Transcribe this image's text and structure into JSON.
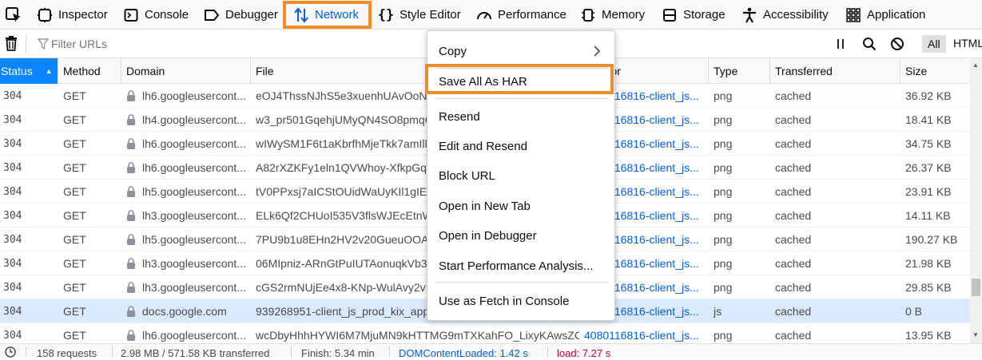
{
  "tabs": [
    {
      "label": "Inspector",
      "icon": "inspector-icon"
    },
    {
      "label": "Console",
      "icon": "console-icon"
    },
    {
      "label": "Debugger",
      "icon": "debugger-icon"
    },
    {
      "label": "Network",
      "icon": "network-icon"
    },
    {
      "label": "Style Editor",
      "icon": "style-editor-icon"
    },
    {
      "label": "Performance",
      "icon": "performance-icon"
    },
    {
      "label": "Memory",
      "icon": "memory-icon"
    },
    {
      "label": "Storage",
      "icon": "storage-icon"
    },
    {
      "label": "Accessibility",
      "icon": "accessibility-icon"
    },
    {
      "label": "Application",
      "icon": "application-icon"
    }
  ],
  "toolbar": {
    "filter_placeholder": "Filter URLs",
    "all_label": "All",
    "html_label": "HTML"
  },
  "columns": [
    "Status",
    "Method",
    "Domain",
    "File",
    "Initiator",
    "Type",
    "Transferred",
    "Size"
  ],
  "rows": [
    {
      "status": "304",
      "method": "GET",
      "domain": "lh6.googleusercont...",
      "file": "eOJ4ThssNJhS5e3xuenhUAvOoNnw",
      "cause": "4080116816-client_js...",
      "type": "png",
      "transferred": "cached",
      "size": "36.92 KB"
    },
    {
      "status": "304",
      "method": "GET",
      "domain": "lh4.googleusercont...",
      "file": "w3_pr501GqehjUMyQN4SO8pmqC",
      "cause": "4080116816-client_js...",
      "type": "png",
      "transferred": "cached",
      "size": "18.41 KB"
    },
    {
      "status": "304",
      "method": "GET",
      "domain": "lh6.googleusercont...",
      "file": "wIWySM1F6t1aKbrfhMjeTkk7amIlh",
      "cause": "4080116816-client_js...",
      "type": "png",
      "transferred": "cached",
      "size": "34.75 KB"
    },
    {
      "status": "304",
      "method": "GET",
      "domain": "lh6.googleusercont...",
      "file": "A82rXZKFy1eln1QVWhoy-XfkpGq7",
      "cause": "4080116816-client_js...",
      "type": "png",
      "transferred": "cached",
      "size": "26.37 KB"
    },
    {
      "status": "304",
      "method": "GET",
      "domain": "lh5.googleusercont...",
      "file": "tV0PPxsj7aICStOUidWaUyKIl1gIEX",
      "cause": "4080116816-client_js...",
      "type": "png",
      "transferred": "cached",
      "size": "23.91 KB"
    },
    {
      "status": "304",
      "method": "GET",
      "domain": "lh3.googleusercont...",
      "file": "ELk6Qf2CHUoI535V3flsWJEcEtnWt",
      "cause": "4080116816-client_js...",
      "type": "png",
      "transferred": "cached",
      "size": "14.11 KB"
    },
    {
      "status": "304",
      "method": "GET",
      "domain": "lh5.googleusercont...",
      "file": "7PU9b1u8EHn2HV2v20GueuOOA",
      "cause": "4080116816-client_js...",
      "type": "png",
      "transferred": "cached",
      "size": "190.27 KB"
    },
    {
      "status": "304",
      "method": "GET",
      "domain": "lh3.googleusercont...",
      "file": "06MIpniz-ARnGtPuIUTAonuqkVb3",
      "cause": "4080116816-client_js...",
      "type": "png",
      "transferred": "cached",
      "size": "21.98 KB"
    },
    {
      "status": "304",
      "method": "GET",
      "domain": "lh3.googleusercont...",
      "file": "cGS2rmNUjEe4x8-KNp-WulAvy2vI",
      "cause": "4080116816-client_js...",
      "type": "png",
      "transferred": "cached",
      "size": "29.85 KB"
    },
    {
      "status": "304",
      "method": "GET",
      "domain": "docs.google.com",
      "file": "939268951-client_js_prod_kix_app",
      "cause": "4080116816-client_js...",
      "type": "js",
      "transferred": "cached",
      "size": "0 B"
    },
    {
      "status": "304",
      "method": "GET",
      "domain": "lh6.googleusercont...",
      "file": "wcDbyHhhHYWI6M7MjuMN9kHTTMG9mTXKahFO_LixyKAwsZCm",
      "cause": "4080116816-client_js...",
      "type": "png",
      "transferred": "cached",
      "size": "13.95 KB"
    }
  ],
  "statusbar": {
    "requests": "158 requests",
    "transferred": "2.98 MB / 571.58 KB transferred",
    "finish": "Finish: 5.34 min",
    "dcl": "DOMContentLoaded: 1.42 s",
    "load": "load: 7.27 s"
  },
  "menu": {
    "copy": "Copy",
    "save_har": "Save All As HAR",
    "resend": "Resend",
    "edit_resend": "Edit and Resend",
    "block_url": "Block URL",
    "open_new_tab": "Open in New Tab",
    "open_debugger": "Open in Debugger",
    "perf_analysis": "Start Performance Analysis...",
    "fetch_console": "Use as Fetch in Console"
  },
  "colors": {
    "accent": "#0a84ff",
    "highlight": "#f28c28",
    "link": "#0060df"
  }
}
